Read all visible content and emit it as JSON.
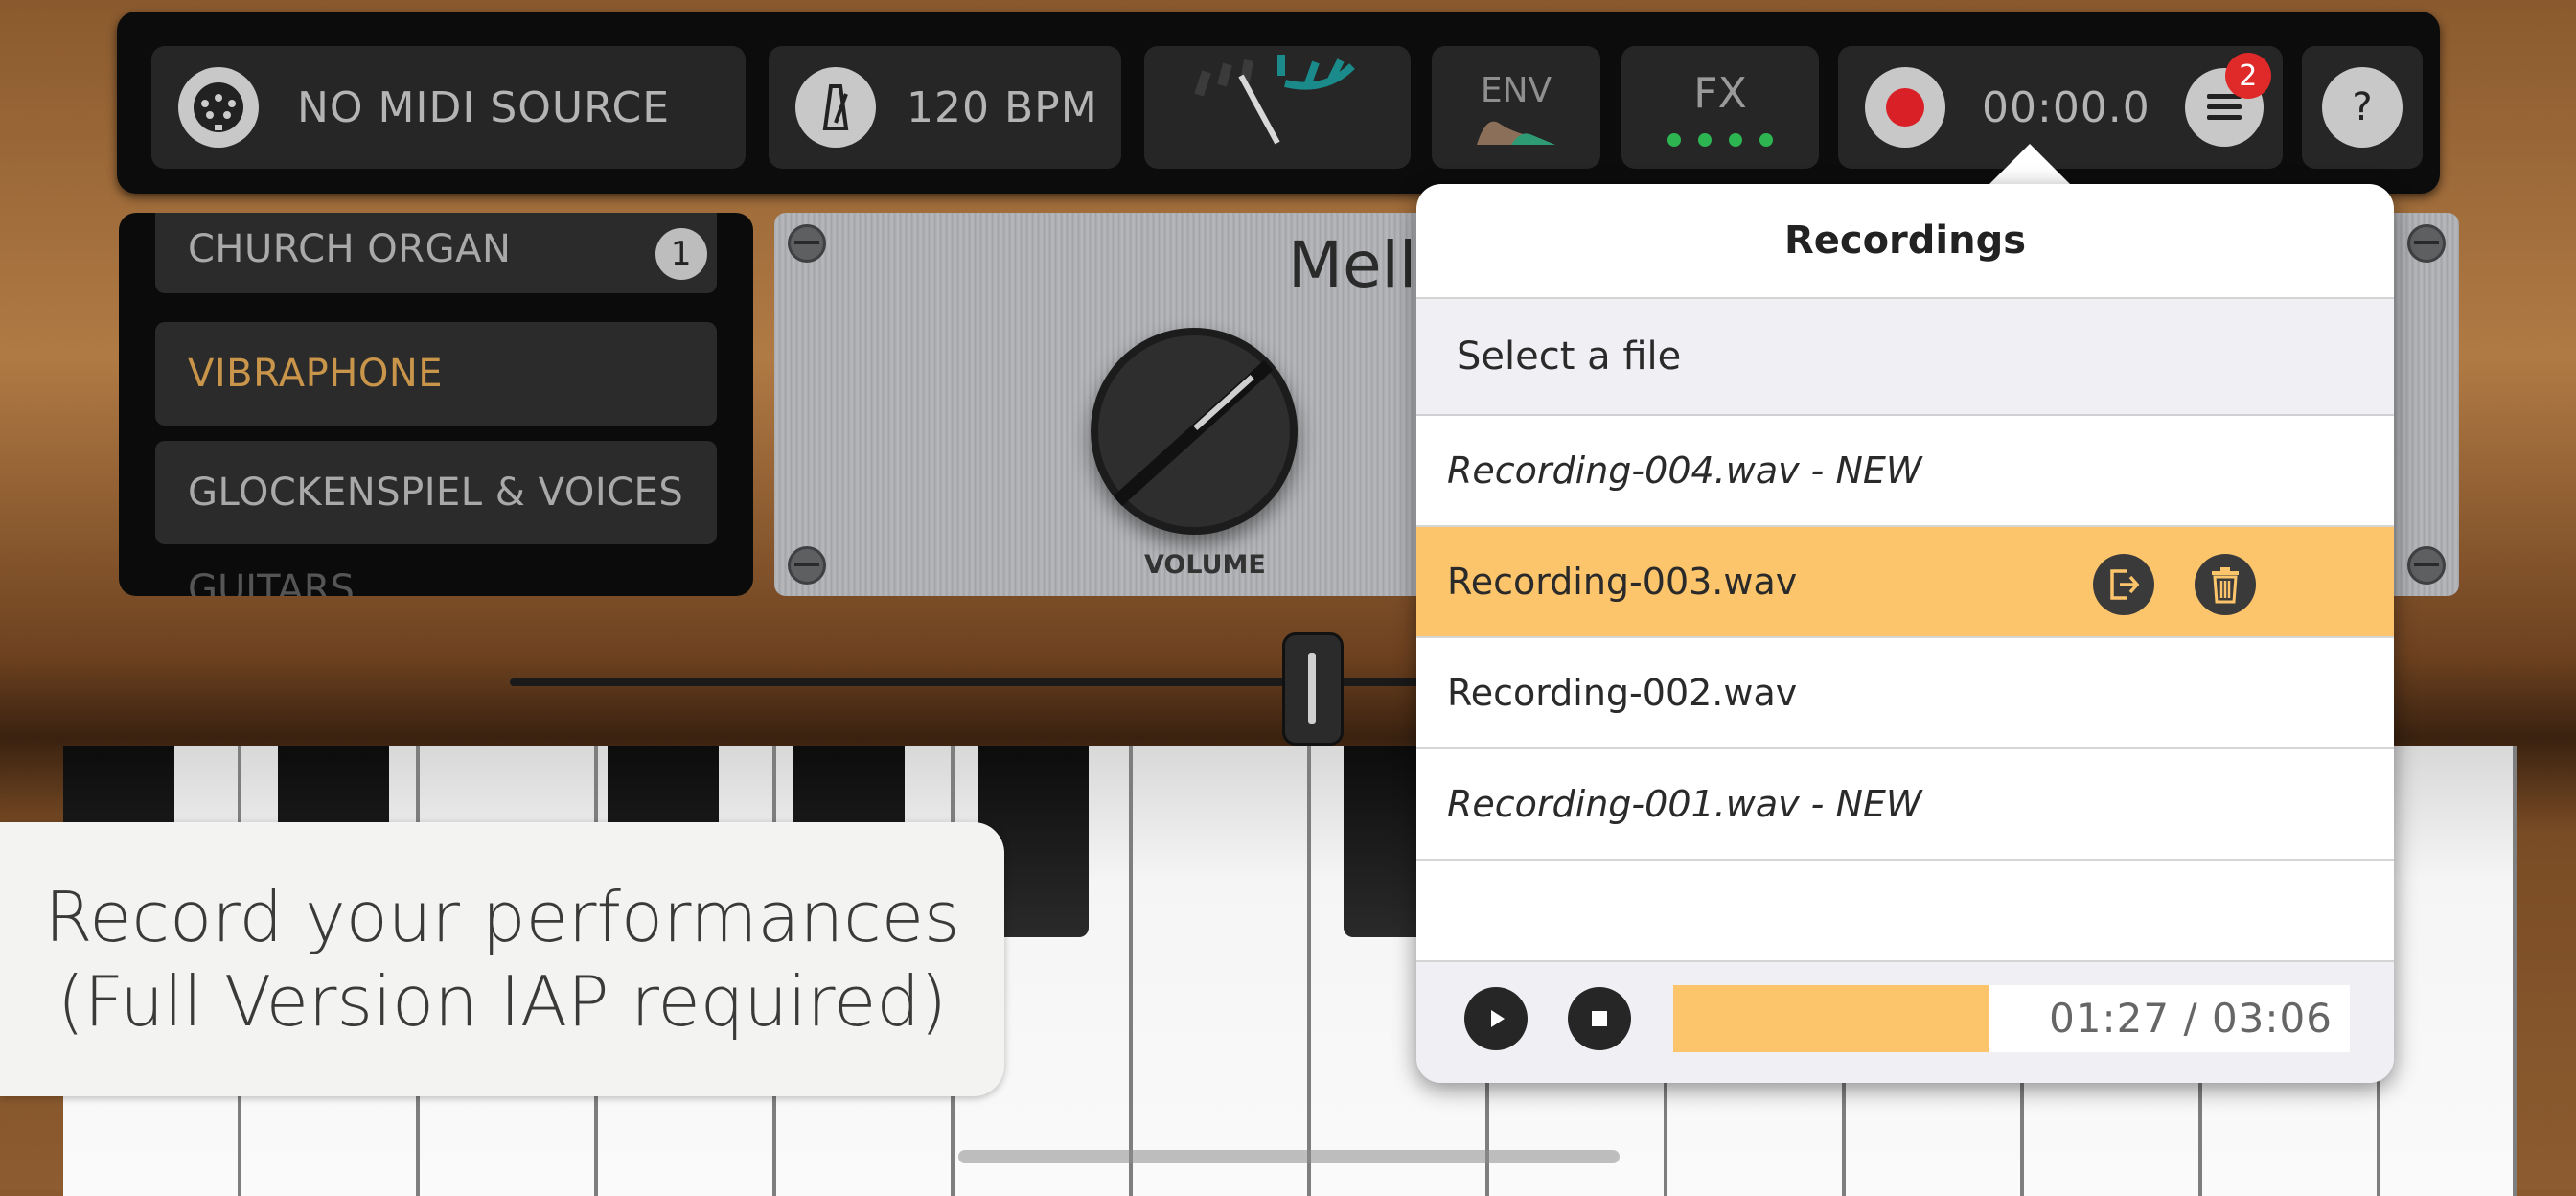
{
  "topbar": {
    "midi_label": "NO MIDI SOURCE",
    "tempo_label": "120 BPM",
    "env_label": "ENV",
    "fx_label": "FX",
    "timer": "00:00.0",
    "menu_badge": "2",
    "help_label": "?"
  },
  "presets": {
    "items": [
      {
        "label": "CHURCH ORGAN",
        "badge": "1"
      },
      {
        "label": "VIBRAPHONE",
        "selected": true
      },
      {
        "label": "GLOCKENSPIEL & VOICES"
      },
      {
        "label": "GUITARS"
      }
    ]
  },
  "instrument": {
    "name": "Mello",
    "volume_label": "VOLUME"
  },
  "recordings": {
    "title": "Recordings",
    "select_label": "Select a file",
    "files": [
      {
        "label": "Recording-004.wav - NEW",
        "is_new": true
      },
      {
        "label": "Recording-003.wav",
        "selected": true
      },
      {
        "label": "Recording-002.wav"
      },
      {
        "label": "Recording-001.wav - NEW",
        "is_new": true
      }
    ],
    "player": {
      "time": "01:27 / 03:06",
      "progress_fraction": 0.468
    }
  },
  "caption": {
    "line1": "Record your performances",
    "line2": "(Full Version IAP required)"
  },
  "colors": {
    "accent": "#fcc56b",
    "record_red": "#d92027",
    "selected_preset_text": "#c8954a",
    "fx_dot_green": "#2db552"
  },
  "icons": [
    "midi-connector-icon",
    "metronome-icon",
    "record-icon",
    "menu-icon",
    "help-icon",
    "share-icon",
    "trash-icon",
    "play-icon",
    "stop-icon"
  ]
}
